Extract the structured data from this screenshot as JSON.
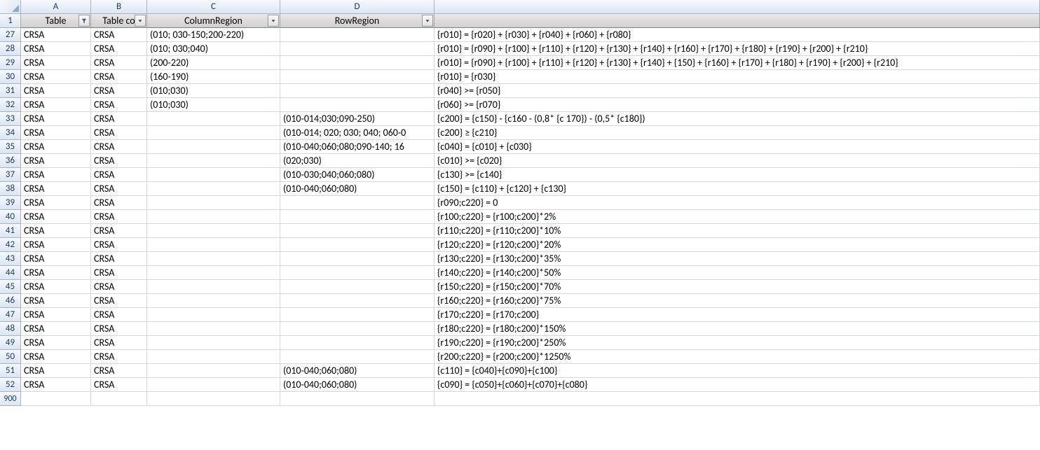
{
  "columns": {
    "A": "A",
    "B": "B",
    "C": "C",
    "D": "D"
  },
  "filterHeaders": {
    "A": "Table",
    "B": "Table co",
    "C": "ColumnRegion",
    "D": "RowRegion"
  },
  "filterActive": {
    "A": true,
    "B": false,
    "C": false,
    "D": false
  },
  "rows": [
    {
      "n": 27,
      "A": "CRSA",
      "B": "CRSA",
      "C": "(010; 030-150;200-220)",
      "D": "",
      "E": "{r010} = {r020} + {r030} + {r040} + {r060} + {r080}"
    },
    {
      "n": 28,
      "A": "CRSA",
      "B": "CRSA",
      "C": "(010; 030;040)",
      "D": "",
      "E": "{r010} = {r090} + {r100} + {r110} + {r120} + {r130} + {r140} + {r160} + {r170} + {r180} + {r190} + {r200} + {r210}"
    },
    {
      "n": 29,
      "A": "CRSA",
      "B": "CRSA",
      "C": "(200-220)",
      "D": "",
      "E": "{r010} = {r090} + {r100} + {r110} + {r120} + {r130} + {r140} + {150} + {r160} + {r170} + {r180} + {r190} + {r200} + {r210}"
    },
    {
      "n": 30,
      "A": "CRSA",
      "B": "CRSA",
      "C": "(160-190)",
      "D": "",
      "E": "{r010} = {r030}"
    },
    {
      "n": 31,
      "A": "CRSA",
      "B": "CRSA",
      "C": "(010;030)",
      "D": "",
      "E": "{r040} >=  {r050}"
    },
    {
      "n": 32,
      "A": "CRSA",
      "B": "CRSA",
      "C": "(010;030)",
      "D": "",
      "E": "{r060} >= {r070}"
    },
    {
      "n": 33,
      "A": "CRSA",
      "B": "CRSA",
      "C": "",
      "D": "(010-014;030;090-250)",
      "E": "{c200} = {c150} - {c160 - (0,8* {c 170}) - (0,5* {c180})"
    },
    {
      "n": 34,
      "A": "CRSA",
      "B": "CRSA",
      "C": "",
      "D": "(010-014; 020; 030; 040; 060-0",
      "E": "{c200} ≥ {c210}"
    },
    {
      "n": 35,
      "A": "CRSA",
      "B": "CRSA",
      "C": "",
      "D": "(010-040;060;080;090-140; 16",
      "E": "{c040} = {c010} + {c030}"
    },
    {
      "n": 36,
      "A": "CRSA",
      "B": "CRSA",
      "C": "",
      "D": "(020;030)",
      "E": "{c010} >= {c020}"
    },
    {
      "n": 37,
      "A": "CRSA",
      "B": "CRSA",
      "C": "",
      "D": "(010-030;040;060;080)",
      "E": "{c130} >= {c140}"
    },
    {
      "n": 38,
      "A": "CRSA",
      "B": "CRSA",
      "C": "",
      "D": "(010-040;060;080)",
      "E": "{c150} = {c110} + {c120} + {c130}"
    },
    {
      "n": 39,
      "A": "CRSA",
      "B": "CRSA",
      "C": "",
      "D": "",
      "E": "{r090;c220} = 0"
    },
    {
      "n": 40,
      "A": "CRSA",
      "B": "CRSA",
      "C": "",
      "D": "",
      "E": "{r100;c220} = {r100;c200}*2%"
    },
    {
      "n": 41,
      "A": "CRSA",
      "B": "CRSA",
      "C": "",
      "D": "",
      "E": "{r110;c220} = {r110;c200}*10%"
    },
    {
      "n": 42,
      "A": "CRSA",
      "B": "CRSA",
      "C": "",
      "D": "",
      "E": "{r120;c220} = {r120;c200}*20%"
    },
    {
      "n": 43,
      "A": "CRSA",
      "B": "CRSA",
      "C": "",
      "D": "",
      "E": "{r130;c220} = {r130;c200}*35%"
    },
    {
      "n": 44,
      "A": "CRSA",
      "B": "CRSA",
      "C": "",
      "D": "",
      "E": "{r140;c220} = {r140;c200}*50%"
    },
    {
      "n": 45,
      "A": "CRSA",
      "B": "CRSA",
      "C": "",
      "D": "",
      "E": "{r150;c220} = {r150;c200}*70%"
    },
    {
      "n": 46,
      "A": "CRSA",
      "B": "CRSA",
      "C": "",
      "D": "",
      "E": "{r160;c220} = {r160;c200}*75%"
    },
    {
      "n": 47,
      "A": "CRSA",
      "B": "CRSA",
      "C": "",
      "D": "",
      "E": "{r170;c220} = {r170;c200}"
    },
    {
      "n": 48,
      "A": "CRSA",
      "B": "CRSA",
      "C": "",
      "D": "",
      "E": "{r180;c220} = {r180;c200}*150%"
    },
    {
      "n": 49,
      "A": "CRSA",
      "B": "CRSA",
      "C": "",
      "D": "",
      "E": "{r190;c220} = {r190;c200}*250%"
    },
    {
      "n": 50,
      "A": "CRSA",
      "B": "CRSA",
      "C": "",
      "D": "",
      "E": "{r200;c220} = {r200;c200}*1250%"
    },
    {
      "n": 51,
      "A": "CRSA",
      "B": "CRSA",
      "C": "",
      "D": "(010-040;060;080)",
      "E": "{c110} = {c040}+{c090}+{c100}"
    },
    {
      "n": 52,
      "A": "CRSA",
      "B": "CRSA",
      "C": "",
      "D": "(010-040;060;080)",
      "E": "{c090} = {c050}+{c060}+{c070}+{c080}"
    }
  ],
  "tailRow": 900
}
